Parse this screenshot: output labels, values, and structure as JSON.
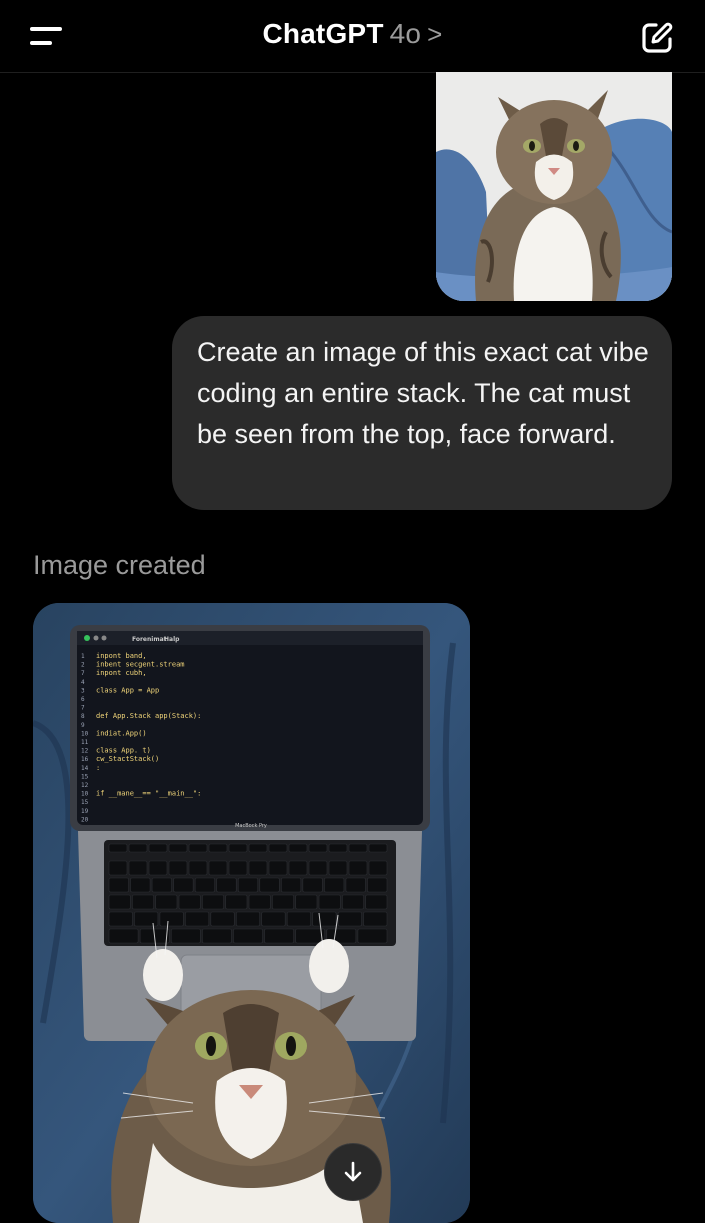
{
  "header": {
    "app_title": "ChatGPT",
    "model": "4o",
    "chevron": ">"
  },
  "icons": {
    "menu": "menu-icon",
    "compose": "compose-icon",
    "scroll_down": "arrow-down-icon"
  },
  "conversation": {
    "user_message": "Create an image of this exact cat vibe coding an entire stack. The cat must be seen from the top, face forward.",
    "assistant_status": "Image created"
  },
  "generated_image": {
    "laptop_label": "MacBock Pry",
    "menu_bar": [
      "Forenimat",
      "Halp"
    ],
    "code_lines": [
      {
        "num": "1",
        "text": "inpont band,"
      },
      {
        "num": "2",
        "text": "inbent secgent.stream"
      },
      {
        "num": "7",
        "text": "inpont cubh,"
      },
      {
        "num": "4",
        "text": ""
      },
      {
        "num": "3",
        "text": "  class App = App"
      },
      {
        "num": "6",
        "text": ""
      },
      {
        "num": "7",
        "text": ""
      },
      {
        "num": "8",
        "text": "  def App.Stack app(Stack):"
      },
      {
        "num": "9",
        "text": ""
      },
      {
        "num": "10",
        "text": "        indiat.App()"
      },
      {
        "num": "11",
        "text": ""
      },
      {
        "num": "12",
        "text": "        class App. t)"
      },
      {
        "num": "16",
        "text": "           cw_StactStack()"
      },
      {
        "num": "14",
        "text": "        :"
      },
      {
        "num": "15",
        "text": ""
      },
      {
        "num": "12",
        "text": ""
      },
      {
        "num": "10",
        "text": "      if __mane__== \"__main__\":"
      },
      {
        "num": "15",
        "text": ""
      },
      {
        "num": "19",
        "text": ""
      },
      {
        "num": "20",
        "text": ""
      }
    ]
  },
  "colors": {
    "background": "#000000",
    "bubble": "#2b2b2b",
    "muted_text": "#9a9a9a",
    "code_text": "#f2d67a"
  }
}
